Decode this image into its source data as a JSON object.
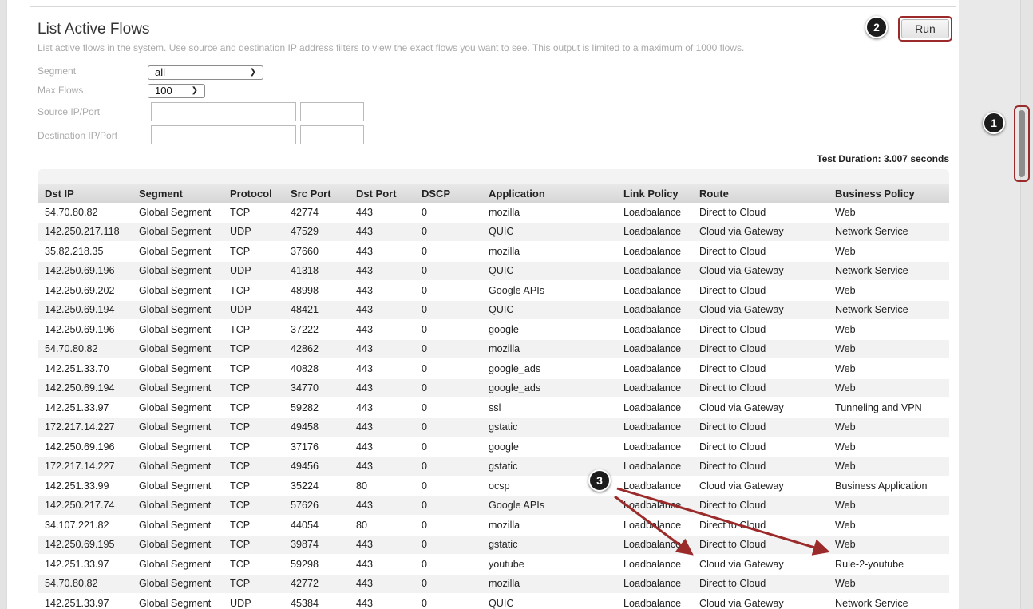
{
  "header": {
    "title": "List Active Flows",
    "description": "List active flows in the system. Use source and destination IP address filters to view the exact flows you want to see. This output is limited to a maximum of 1000 flows.",
    "run_label": "Run"
  },
  "filters": {
    "segment_label": "Segment",
    "segment_value": "all",
    "max_flows_label": "Max Flows",
    "max_flows_value": "100",
    "source_label": "Source IP/Port",
    "destination_label": "Destination IP/Port"
  },
  "test_duration": "Test Duration: 3.007 seconds",
  "table": {
    "columns": [
      "Dst IP",
      "Segment",
      "Protocol",
      "Src Port",
      "Dst Port",
      "DSCP",
      "Application",
      "Link Policy",
      "Route",
      "Business Policy"
    ],
    "rows": [
      [
        "54.70.80.82",
        "Global Segment",
        "TCP",
        "42774",
        "443",
        "0",
        "mozilla",
        "Loadbalance",
        "Direct to Cloud",
        "Web"
      ],
      [
        "142.250.217.118",
        "Global Segment",
        "UDP",
        "47529",
        "443",
        "0",
        "QUIC",
        "Loadbalance",
        "Cloud via Gateway",
        "Network Service"
      ],
      [
        "35.82.218.35",
        "Global Segment",
        "TCP",
        "37660",
        "443",
        "0",
        "mozilla",
        "Loadbalance",
        "Direct to Cloud",
        "Web"
      ],
      [
        "142.250.69.196",
        "Global Segment",
        "UDP",
        "41318",
        "443",
        "0",
        "QUIC",
        "Loadbalance",
        "Cloud via Gateway",
        "Network Service"
      ],
      [
        "142.250.69.202",
        "Global Segment",
        "TCP",
        "48998",
        "443",
        "0",
        "Google APIs",
        "Loadbalance",
        "Direct to Cloud",
        "Web"
      ],
      [
        "142.250.69.194",
        "Global Segment",
        "UDP",
        "48421",
        "443",
        "0",
        "QUIC",
        "Loadbalance",
        "Cloud via Gateway",
        "Network Service"
      ],
      [
        "142.250.69.196",
        "Global Segment",
        "TCP",
        "37222",
        "443",
        "0",
        "google",
        "Loadbalance",
        "Direct to Cloud",
        "Web"
      ],
      [
        "54.70.80.82",
        "Global Segment",
        "TCP",
        "42862",
        "443",
        "0",
        "mozilla",
        "Loadbalance",
        "Direct to Cloud",
        "Web"
      ],
      [
        "142.251.33.70",
        "Global Segment",
        "TCP",
        "40828",
        "443",
        "0",
        "google_ads",
        "Loadbalance",
        "Direct to Cloud",
        "Web"
      ],
      [
        "142.250.69.194",
        "Global Segment",
        "TCP",
        "34770",
        "443",
        "0",
        "google_ads",
        "Loadbalance",
        "Direct to Cloud",
        "Web"
      ],
      [
        "142.251.33.97",
        "Global Segment",
        "TCP",
        "59282",
        "443",
        "0",
        "ssl",
        "Loadbalance",
        "Cloud via Gateway",
        "Tunneling and VPN"
      ],
      [
        "172.217.14.227",
        "Global Segment",
        "TCP",
        "49458",
        "443",
        "0",
        "gstatic",
        "Loadbalance",
        "Direct to Cloud",
        "Web"
      ],
      [
        "142.250.69.196",
        "Global Segment",
        "TCP",
        "37176",
        "443",
        "0",
        "google",
        "Loadbalance",
        "Direct to Cloud",
        "Web"
      ],
      [
        "172.217.14.227",
        "Global Segment",
        "TCP",
        "49456",
        "443",
        "0",
        "gstatic",
        "Loadbalance",
        "Direct to Cloud",
        "Web"
      ],
      [
        "142.251.33.99",
        "Global Segment",
        "TCP",
        "35224",
        "80",
        "0",
        "ocsp",
        "Loadbalance",
        "Cloud via Gateway",
        "Business Application"
      ],
      [
        "142.250.217.74",
        "Global Segment",
        "TCP",
        "57626",
        "443",
        "0",
        "Google APIs",
        "Loadbalance",
        "Direct to Cloud",
        "Web"
      ],
      [
        "34.107.221.82",
        "Global Segment",
        "TCP",
        "44054",
        "80",
        "0",
        "mozilla",
        "Loadbalance",
        "Direct to Cloud",
        "Web"
      ],
      [
        "142.250.69.195",
        "Global Segment",
        "TCP",
        "39874",
        "443",
        "0",
        "gstatic",
        "Loadbalance",
        "Direct to Cloud",
        "Web"
      ],
      [
        "142.251.33.97",
        "Global Segment",
        "TCP",
        "59298",
        "443",
        "0",
        "youtube",
        "Loadbalance",
        "Cloud via Gateway",
        "Rule-2-youtube"
      ],
      [
        "54.70.80.82",
        "Global Segment",
        "TCP",
        "42772",
        "443",
        "0",
        "mozilla",
        "Loadbalance",
        "Direct to Cloud",
        "Web"
      ],
      [
        "142.251.33.97",
        "Global Segment",
        "UDP",
        "45384",
        "443",
        "0",
        "QUIC",
        "Loadbalance",
        "Cloud via Gateway",
        "Network Service"
      ]
    ]
  },
  "annotations": {
    "badge_1": "1",
    "badge_2": "2",
    "badge_3": "3"
  },
  "colors": {
    "annotation_red": "#9b2a2a",
    "header_text": "#333333"
  },
  "icons": {
    "select_chevron": "chevron-down-icon"
  }
}
